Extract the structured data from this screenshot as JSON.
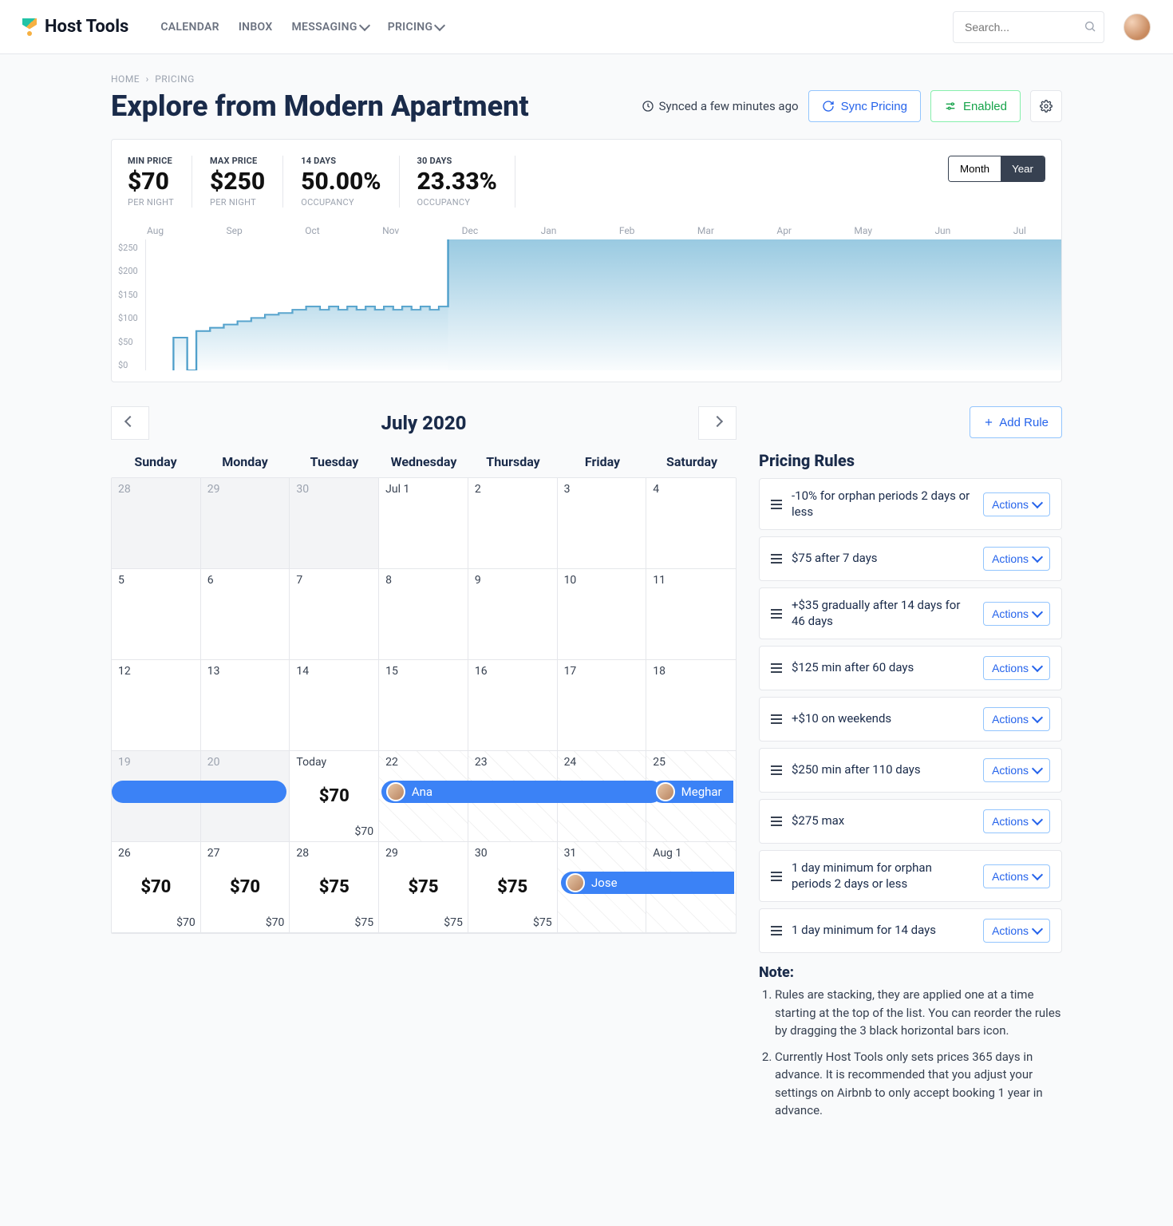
{
  "brand": "Host Tools",
  "nav": {
    "calendar": "CALENDAR",
    "inbox": "INBOX",
    "messaging": "MESSAGING",
    "pricing": "PRICING"
  },
  "search": {
    "placeholder": "Search..."
  },
  "crumbs": {
    "home": "HOME",
    "pricing": "PRICING"
  },
  "page_title": "Explore from Modern Apartment",
  "sync_text": "Synced a few minutes ago",
  "buttons": {
    "sync_pricing": "Sync Pricing",
    "enabled": "Enabled"
  },
  "stats": {
    "min": {
      "label": "MIN PRICE",
      "value": "$70",
      "sub": "PER NIGHT"
    },
    "max": {
      "label": "MAX PRICE",
      "value": "$250",
      "sub": "PER NIGHT"
    },
    "d14": {
      "label": "14 DAYS",
      "value": "50.00%",
      "sub": "OCCUPANCY"
    },
    "d30": {
      "label": "30 DAYS",
      "value": "23.33%",
      "sub": "OCCUPANCY"
    }
  },
  "toggle": {
    "month": "Month",
    "year": "Year"
  },
  "chart_data": {
    "type": "area",
    "x_labels": [
      "Aug",
      "Sep",
      "Oct",
      "Nov",
      "Dec",
      "Jan",
      "Feb",
      "Mar",
      "Apr",
      "May",
      "Jun",
      "Jul"
    ],
    "y_labels": [
      "$250",
      "$200",
      "$150",
      "$100",
      "$50",
      "$0"
    ],
    "ylim": [
      0,
      250
    ],
    "series": [
      {
        "name": "Price",
        "values": [
          70,
          100,
          120,
          125,
          250,
          250,
          250,
          250,
          250,
          250,
          250,
          250
        ]
      }
    ]
  },
  "cal": {
    "title": "July 2020",
    "dow": [
      "Sunday",
      "Monday",
      "Tuesday",
      "Wednesday",
      "Thursday",
      "Friday",
      "Saturday"
    ],
    "rows": [
      [
        {
          "num": "28",
          "out": true
        },
        {
          "num": "29",
          "out": true
        },
        {
          "num": "30",
          "out": true
        },
        {
          "num": "Jul 1"
        },
        {
          "num": "2"
        },
        {
          "num": "3"
        },
        {
          "num": "4"
        }
      ],
      [
        {
          "num": "5"
        },
        {
          "num": "6"
        },
        {
          "num": "7"
        },
        {
          "num": "8"
        },
        {
          "num": "9"
        },
        {
          "num": "10"
        },
        {
          "num": "11"
        }
      ],
      [
        {
          "num": "12"
        },
        {
          "num": "13"
        },
        {
          "num": "14"
        },
        {
          "num": "15"
        },
        {
          "num": "16"
        },
        {
          "num": "17"
        },
        {
          "num": "18"
        }
      ],
      [
        {
          "num": "19",
          "out": true
        },
        {
          "num": "20",
          "out": true
        },
        {
          "num": "Today",
          "p1": "$70",
          "p2": "$70"
        },
        {
          "num": "22",
          "hatched": true
        },
        {
          "num": "23",
          "hatched": true
        },
        {
          "num": "24",
          "hatched": true
        },
        {
          "num": "25",
          "hatched": true
        }
      ],
      [
        {
          "num": "26",
          "p1": "$70",
          "p2": "$70"
        },
        {
          "num": "27",
          "p1": "$70",
          "p2": "$70"
        },
        {
          "num": "28",
          "p1": "$75",
          "p2": "$75"
        },
        {
          "num": "29",
          "p1": "$75",
          "p2": "$75"
        },
        {
          "num": "30",
          "p1": "$75",
          "p2": "$75"
        },
        {
          "num": "31",
          "hatched": true
        },
        {
          "num": "Aug 1",
          "hatched": true
        }
      ]
    ],
    "bars": {
      "b1": {
        "name": ""
      },
      "b2": {
        "name": "Ana"
      },
      "b3": {
        "name": "Meghar"
      },
      "b4": {
        "name": "Jose"
      }
    }
  },
  "rules": {
    "add": "Add Rule",
    "heading": "Pricing Rules",
    "actions": "Actions",
    "items": [
      "-10% for orphan periods 2 days or less",
      "$75 after 7 days",
      "+$35 gradually after 14 days for 46 days",
      "$125 min after 60 days",
      "+$10 on weekends",
      "$250 min after 110 days",
      "$275 max",
      "1 day minimum for orphan periods 2 days or less",
      "1 day minimum for 14 days"
    ],
    "note_heading": "Note:",
    "notes": [
      "Rules are stacking, they are applied one at a time starting at the top of the list. You can reorder the rules by dragging the 3 black horizontal bars icon.",
      "Currently Host Tools only sets prices 365 days in advance. It is recommended that you adjust your settings on Airbnb to only accept booking 1 year in advance."
    ]
  }
}
